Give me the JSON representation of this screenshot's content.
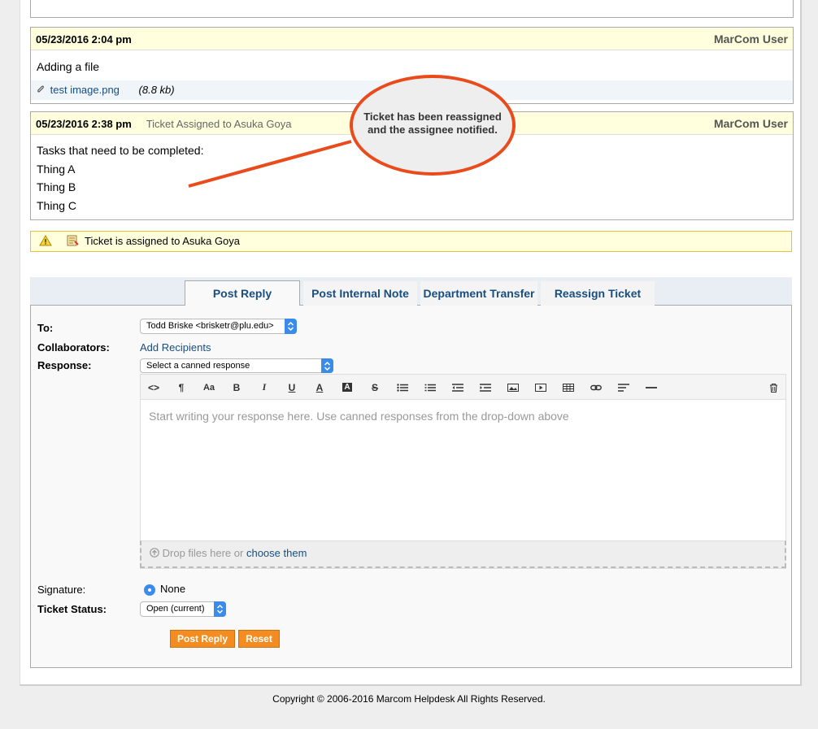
{
  "threads": [
    {
      "date": "05/23/2016 2:04 pm",
      "title": "",
      "poster": "MarCom User",
      "body": [
        "Adding a file"
      ],
      "attachment": {
        "name": "test image.png",
        "size": "(8.8 kb)"
      }
    },
    {
      "date": "05/23/2016 2:38 pm",
      "title": "Ticket Assigned to Asuka Goya",
      "poster": "MarCom User",
      "body": [
        "Tasks that need to be completed:",
        "Thing A",
        "Thing B",
        "Thing C"
      ]
    }
  ],
  "notice": {
    "text": "Ticket is assigned to Asuka Goya"
  },
  "callout": {
    "line1": "Ticket has been reassigned",
    "line2": "and the assignee notified."
  },
  "tabs": [
    {
      "label": "Post Reply",
      "active": true
    },
    {
      "label": "Post Internal Note",
      "active": false
    },
    {
      "label": "Department Transfer",
      "active": false
    },
    {
      "label": "Reassign Ticket",
      "active": false
    }
  ],
  "reply": {
    "to_label": "To:",
    "to_value": "Todd Briske <brisketr@plu.edu>",
    "collab_label": "Collaborators:",
    "collab_link": "Add Recipients",
    "response_label": "Response:",
    "canned_value": "Select a canned response",
    "editor_placeholder": "Start writing your response here. Use canned responses from the drop-down above",
    "dropzone_text": "Drop files here or",
    "dropzone_link": "choose them",
    "signature_label": "Signature:",
    "signature_value": "None",
    "status_label": "Ticket Status:",
    "status_value": "Open (current)",
    "post_button": "Post Reply",
    "reset_button": "Reset"
  },
  "toolbar_icons": [
    "code-icon",
    "paragraph-icon",
    "font-size-icon",
    "bold-icon",
    "italic-icon",
    "underline-icon",
    "font-color-icon",
    "highlight-icon",
    "strikethrough-icon",
    "unordered-list-icon",
    "ordered-list-icon",
    "outdent-icon",
    "indent-icon",
    "image-icon",
    "video-icon",
    "table-icon",
    "link-icon",
    "align-icon",
    "horizontal-rule-icon",
    "trash-icon"
  ],
  "footer": {
    "copyright": "Copyright © 2006-2016 Marcom Helpdesk All Rights Reserved."
  },
  "colors": {
    "accent_link": "#184e81",
    "callout_border": "#ea4b1c",
    "button": "#f48d21",
    "header_bg": "#ffffdd"
  }
}
